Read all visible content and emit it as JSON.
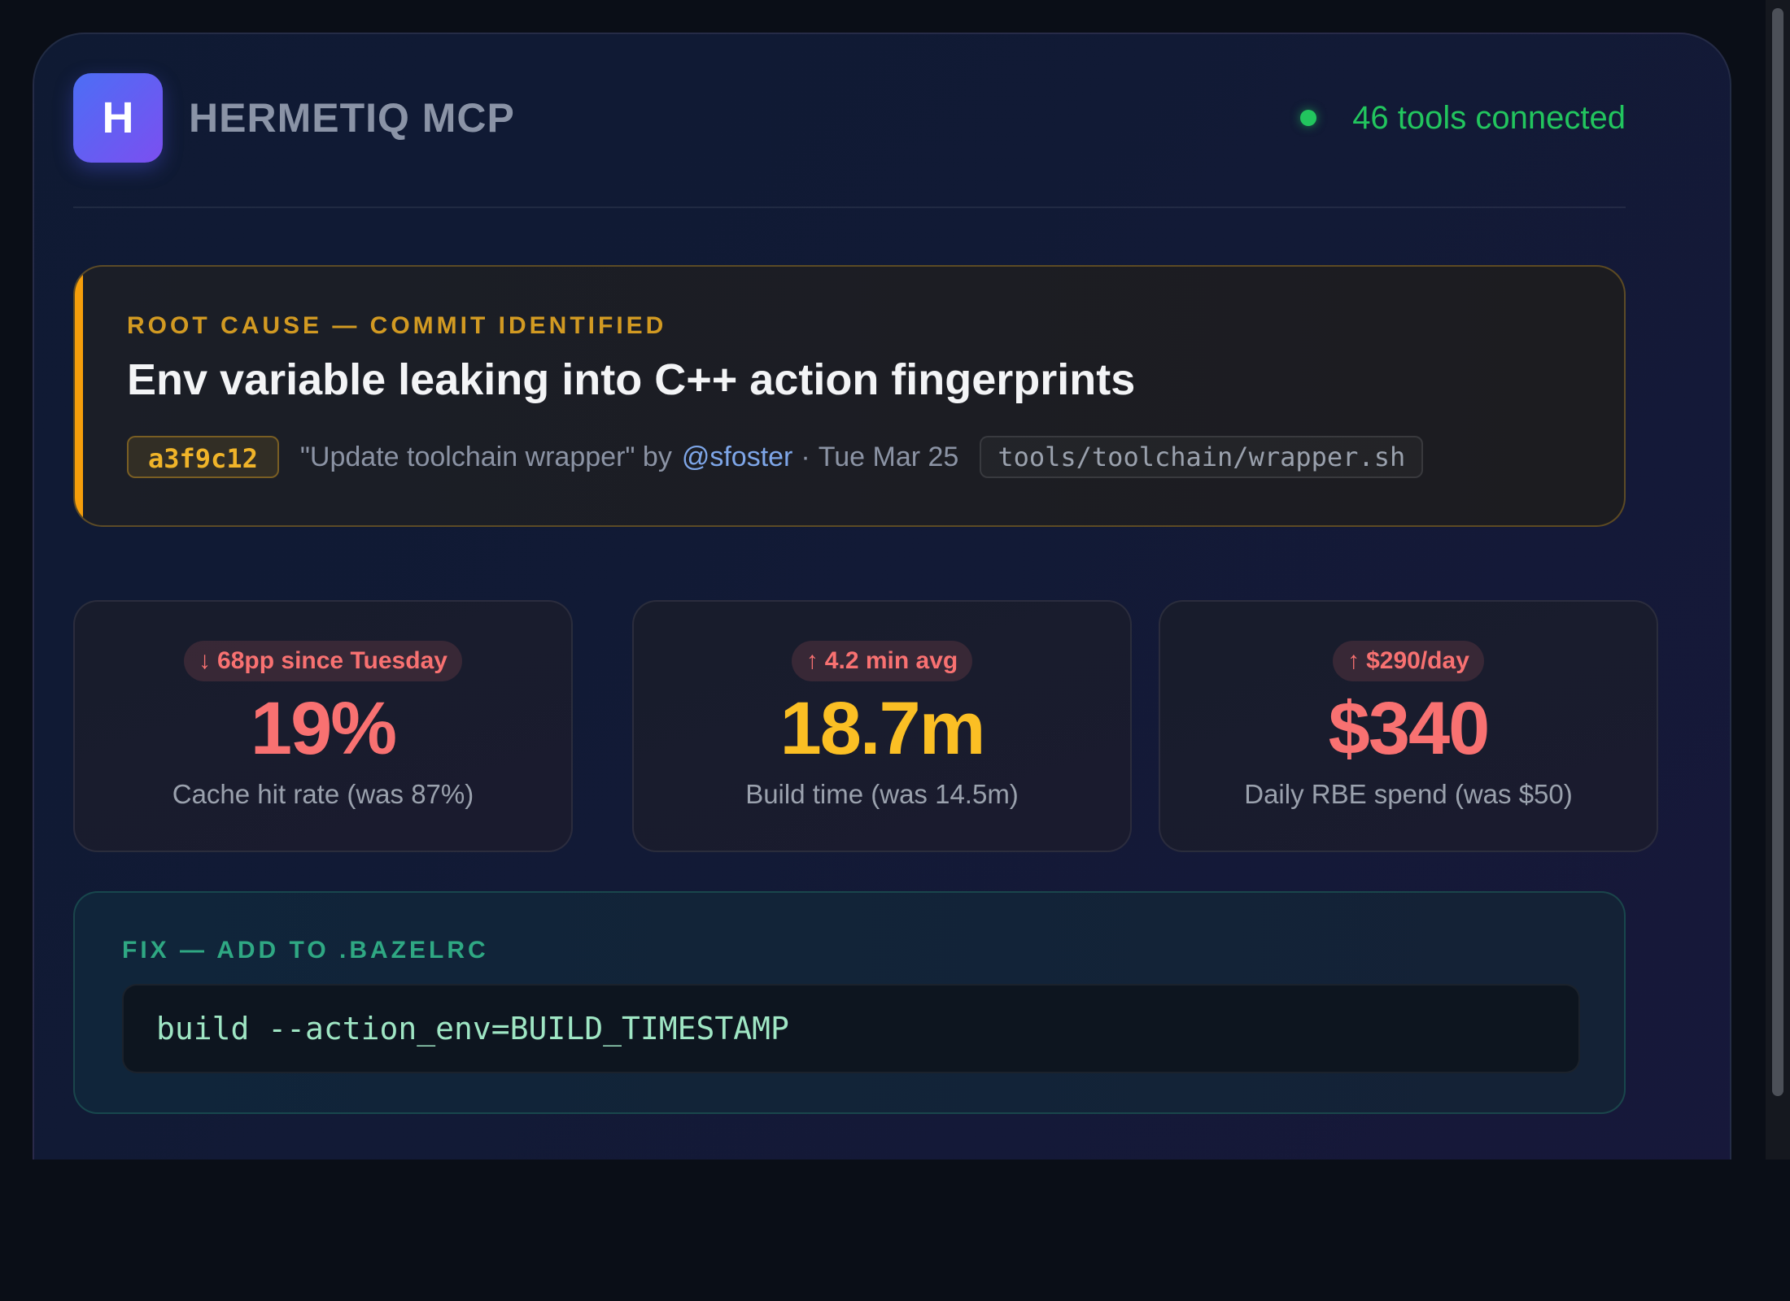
{
  "header": {
    "logo_letter": "H",
    "app_title": "HERMETIQ MCP",
    "status_text": "46 tools connected"
  },
  "root_cause": {
    "eyebrow": "ROOT CAUSE — COMMIT IDENTIFIED",
    "title": "Env variable leaking into C++ action fingerprints",
    "commit_sha": "a3f9c12",
    "commit_message": "\"Update toolchain wrapper\" by",
    "author": "@sfoster",
    "separator": "·",
    "date": "Tue Mar 25",
    "file_path": "tools/toolchain/wrapper.sh"
  },
  "metrics": [
    {
      "badge_arrow": "↓",
      "badge_text": "68pp since Tuesday",
      "value": "19%",
      "label": "Cache hit rate (was 87%)"
    },
    {
      "badge_arrow": "↑",
      "badge_text": "4.2 min avg",
      "value": "18.7m",
      "label": "Build time (was 14.5m)"
    },
    {
      "badge_arrow": "↑",
      "badge_text": "$290/day",
      "value": "$340",
      "label": "Daily RBE spend (was $50)"
    }
  ],
  "fix": {
    "eyebrow": "FIX — ADD TO .BAZELRC",
    "code": "build --action_env=BUILD_TIMESTAMP"
  },
  "colors": {
    "status_green": "#22c55e",
    "accent_amber": "#f59e0b",
    "metric_red": "#f87171",
    "metric_amber": "#fbbf24",
    "fix_green": "#2fa883"
  }
}
